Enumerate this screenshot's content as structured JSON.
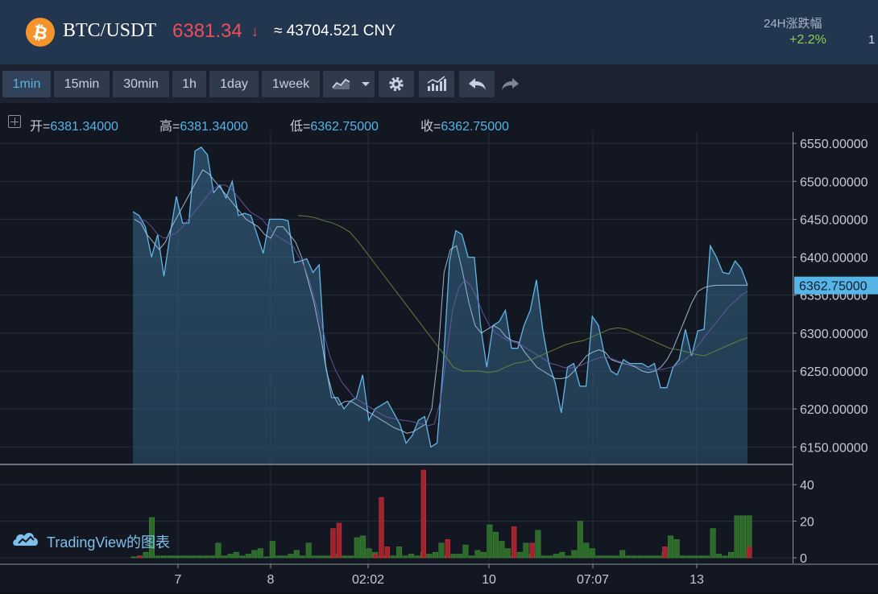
{
  "header": {
    "coin_icon": "bitcoin-icon",
    "pair": "BTC/USDT",
    "price": "6381.34",
    "arrow": "↓",
    "cny": "≈ 43704.521 CNY",
    "change_label": "24H涨跌幅",
    "change_value": "+2.2%",
    "cut_off_text": "1"
  },
  "toolbar": {
    "intervals": [
      "1min",
      "15min",
      "30min",
      "1h",
      "1day",
      "1week"
    ],
    "active_interval": "1min",
    "icons": [
      "line-chart-icon",
      "dropdown-caret-icon",
      "gear-icon",
      "indicators-icon",
      "undo-icon",
      "redo-icon"
    ]
  },
  "ohlc": {
    "open_label": "开=",
    "open_value": "6381.34000",
    "high_label": "高=",
    "high_value": "6381.34000",
    "low_label": "低=",
    "low_value": "6362.75000",
    "close_label": "收=",
    "close_value": "6362.75000"
  },
  "branding": {
    "text": "TradingView的图表",
    "icon": "tradingview-cloud-icon"
  },
  "colors": {
    "price_line": "#5fb8e8",
    "ma_short": "#a5c8e0",
    "ma_mid": "#6b5aa8",
    "ma_long": "#6d8a3c",
    "volume_up": "#2d6a2a",
    "volume_down": "#a3232c",
    "price_down": "#ec4f5b",
    "change_up": "#8ccf52"
  },
  "chart_data": [
    {
      "type": "area",
      "y_ticks": [
        "6550.00000",
        "6500.00000",
        "6450.00000",
        "6400.00000",
        "6350.00000",
        "6300.00000",
        "6250.00000",
        "6200.00000",
        "6150.00000"
      ],
      "x_ticks": [
        "7",
        "8",
        "02:02",
        "10",
        "07:07",
        "13"
      ],
      "ylim": [
        6128,
        6565
      ],
      "last_price_label": "6362.75000",
      "grid": true,
      "series": [
        {
          "values": [
            6460,
            6455,
            6440,
            6400,
            6430,
            6375,
            6430,
            6480,
            6445,
            6445,
            6540,
            6545,
            6535,
            6485,
            6495,
            6478,
            6500,
            6455,
            6458,
            6455,
            6430,
            6405,
            6450,
            6450,
            6450,
            6448,
            6393,
            6395,
            6398,
            6380,
            6390,
            6260,
            6215,
            6215,
            6200,
            6210,
            6215,
            6245,
            6185,
            6200,
            6205,
            6210,
            6195,
            6180,
            6155,
            6165,
            6185,
            6190,
            6150,
            6155,
            6260,
            6395,
            6435,
            6430,
            6400,
            6400,
            6310,
            6255,
            6310,
            6315,
            6330,
            6280,
            6280,
            6310,
            6330,
            6370,
            6305,
            6260,
            6235,
            6195,
            6255,
            6260,
            6230,
            6230,
            6322,
            6310,
            6270,
            6250,
            6245,
            6265,
            6260,
            6260,
            6260,
            6255,
            6260,
            6228,
            6228,
            6255,
            6265,
            6305,
            6270,
            6303,
            6305,
            6415,
            6400,
            6380,
            6378,
            6395,
            6385,
            6363
          ]
        },
        {
          "values": [
            6450,
            6445,
            6430,
            6420,
            6410,
            6420,
            6440,
            6455,
            6470,
            6485,
            6500,
            6515,
            6510,
            6500,
            6490,
            6480,
            6470,
            6460,
            6450,
            6445,
            6440,
            6430,
            6425,
            6440,
            6440,
            6430,
            6420,
            6400,
            6370,
            6340,
            6300,
            6250,
            6220,
            6205,
            6210,
            6210,
            6205,
            6200,
            6195,
            6190,
            6185,
            6180,
            6175,
            6172,
            6168,
            6170,
            6175,
            6180,
            6200,
            6270,
            6380,
            6410,
            6415,
            6380,
            6340,
            6310,
            6300,
            6305,
            6310,
            6305,
            6295,
            6290,
            6288,
            6275,
            6265,
            6255,
            6250,
            6245,
            6240,
            6240,
            6242,
            6250,
            6260,
            6270,
            6275,
            6278,
            6275,
            6265,
            6262,
            6260,
            6258,
            6255,
            6250,
            6248,
            6250,
            6255,
            6265,
            6280,
            6300,
            6320,
            6340,
            6355,
            6360,
            6362,
            6363,
            6363,
            6363,
            6363,
            6363,
            6363
          ]
        },
        {
          "values": [
            6450,
            6448,
            6440,
            6430,
            6425,
            6428,
            6432,
            6440,
            6450,
            6460,
            6470,
            6480,
            6490,
            6495,
            6495,
            6490,
            6480,
            6470,
            6460,
            6455,
            6450,
            6440,
            6430,
            6425,
            6420,
            6415,
            6400,
            6385,
            6360,
            6330,
            6300,
            6270,
            6250,
            6235,
            6225,
            6215,
            6210,
            6205,
            6200,
            6195,
            6190,
            6188,
            6186,
            6185,
            6184,
            6182,
            6180,
            6178,
            6180,
            6210,
            6270,
            6330,
            6360,
            6370,
            6362,
            6345,
            6325,
            6310,
            6300,
            6295,
            6290,
            6288,
            6285,
            6280,
            6275,
            6270,
            6265,
            6260,
            6258,
            6255,
            6254,
            6255,
            6258,
            6262,
            6265,
            6268,
            6268,
            6266,
            6263,
            6260,
            6258,
            6256,
            6254,
            6252,
            6252,
            6252,
            6254,
            6256,
            6260,
            6266,
            6274,
            6284,
            6295,
            6305,
            6315,
            6325,
            6335,
            6342,
            6350,
            6355
          ]
        },
        {
          "values": [
            6455,
            6454,
            6452,
            6448,
            6445,
            6440,
            6433,
            6420,
            6405,
            6390,
            6375,
            6360,
            6345,
            6330,
            6315,
            6300,
            6285,
            6270,
            6255,
            6250,
            6250,
            6250,
            6248,
            6250,
            6255,
            6260,
            6262,
            6265,
            6270,
            6275,
            6280,
            6285,
            6288,
            6290,
            6295,
            6300,
            6305,
            6307,
            6305,
            6300,
            6295,
            6290,
            6285,
            6280,
            6278,
            6275,
            6272,
            6270,
            6275,
            6280,
            6285,
            6290,
            6294
          ]
        }
      ]
    },
    {
      "type": "bar",
      "y_ticks": [
        "40",
        "20",
        "0"
      ],
      "ylim": [
        0,
        48
      ],
      "series": [
        {
          "values": [
            0.5,
            1,
            3,
            22,
            1,
            1,
            1,
            1,
            1,
            1,
            1,
            1,
            1,
            1,
            8,
            1,
            2,
            3,
            1,
            2,
            4,
            5,
            0.5,
            9,
            1,
            1,
            2,
            4,
            1,
            8,
            1,
            1,
            1,
            1,
            2,
            1,
            1,
            11,
            12,
            5,
            3,
            1,
            1,
            1,
            6,
            1,
            2,
            1,
            3,
            2,
            3,
            8,
            1,
            2,
            2,
            7,
            1,
            4,
            3,
            18,
            14,
            9,
            5,
            1,
            3,
            8,
            2,
            15,
            1,
            1,
            2,
            3,
            1,
            4,
            20,
            8,
            5,
            1,
            1,
            1,
            1,
            4,
            1,
            1,
            1,
            1,
            1,
            1,
            3,
            12,
            10,
            1,
            1,
            1,
            1,
            1,
            16,
            2,
            1,
            3,
            23,
            23,
            23
          ]
        },
        {
          "values": [
            0,
            1,
            0,
            0,
            0,
            0,
            0,
            0,
            0,
            0,
            0,
            0,
            0,
            0,
            0,
            0,
            0,
            0,
            0,
            0,
            0,
            0,
            0,
            0,
            0,
            0,
            0,
            0,
            0,
            0,
            0,
            0,
            0,
            16,
            19,
            0,
            0,
            0,
            0,
            0,
            2,
            33,
            6,
            0,
            0,
            0,
            0,
            0,
            48,
            0,
            0,
            0,
            10,
            0,
            0,
            0,
            0,
            0,
            0,
            0,
            0,
            0,
            0,
            17,
            0,
            0,
            8,
            0,
            0,
            0,
            0,
            0,
            0,
            0,
            0,
            0,
            0,
            0,
            0,
            0,
            0,
            0,
            0,
            0,
            0,
            0,
            0,
            0,
            6,
            0,
            0,
            0,
            0,
            0,
            0,
            0,
            0,
            0,
            0,
            0,
            0,
            0,
            6
          ]
        }
      ]
    }
  ]
}
